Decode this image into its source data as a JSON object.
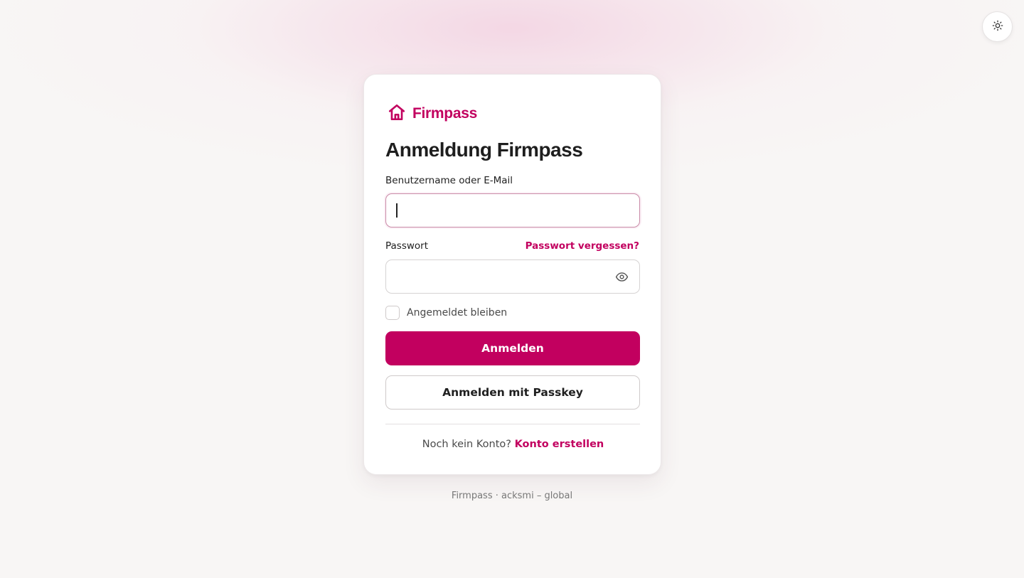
{
  "brand": {
    "name": "Firmpass",
    "accent_color": "#c2005f",
    "logo_icon": "home-icon"
  },
  "theme_toggle": {
    "icon": "sun-icon"
  },
  "login": {
    "title": "Anmeldung Firmpass",
    "username_label": "Benutzername oder E-Mail",
    "username_value": "",
    "password_label": "Passwort",
    "password_value": "",
    "forgot_password": "Passwort vergessen?",
    "password_toggle_icon": "eye-icon",
    "remember_label": "Angemeldet bleiben",
    "remember_checked": false,
    "submit_label": "Anmelden",
    "passkey_label": "Anmelden mit Passkey",
    "no_account_text": "Noch kein Konto?",
    "create_account_link": "Konto erstellen"
  },
  "footer": {
    "text": "Firmpass · acksmi – global"
  }
}
